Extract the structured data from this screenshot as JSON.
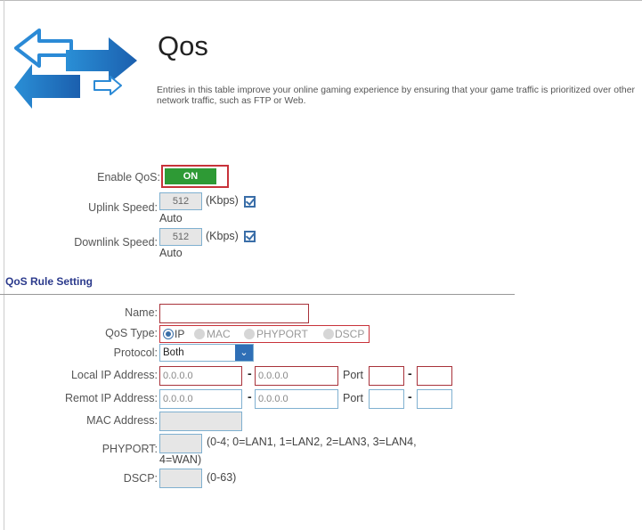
{
  "page": {
    "title": "Qos",
    "description": "Entries in this table improve your online gaming experience by ensuring that your game traffic is prioritized over other network traffic, such as FTP or Web."
  },
  "icons": {
    "logo": "bidirectional-arrows-logo-icon"
  },
  "colors": {
    "toggle_on": "#2e9a35",
    "highlight_border": "#c8323a",
    "section_title": "#2b3a8c",
    "select_arrow": "#2f6fb6"
  },
  "enable_qos": {
    "label": "Enable QoS:",
    "toggle_label": "ON",
    "state": "on"
  },
  "uplink": {
    "label": "Uplink Speed:",
    "value": "512",
    "unit": "(Kbps)",
    "auto_label": "Auto",
    "auto_checked": true
  },
  "downlink": {
    "label": "Downlink Speed:",
    "value": "512",
    "unit": "(Kbps)",
    "auto_label": "Auto",
    "auto_checked": true
  },
  "rule": {
    "section_title": "QoS Rule Setting",
    "name_label": "Name:",
    "name_value": "",
    "qos_type_label": "QoS Type:",
    "qos_types": [
      "IP",
      "MAC",
      "PHYPORT",
      "DSCP"
    ],
    "qos_type_selected": "IP",
    "protocol_label": "Protocol:",
    "protocol_value": "Both",
    "local_ip_label": "Local IP Address:",
    "local_ip_start": "0.0.0.0",
    "local_ip_end": "0.0.0.0",
    "remote_ip_label": "Remot IP Address:",
    "remote_ip_start": "0.0.0.0",
    "remote_ip_end": "0.0.0.0",
    "port_label": "Port",
    "range_separator": "-",
    "mac_label": "MAC Address:",
    "phyport_label": "PHYPORT:",
    "phyport_hint_line1": "(0-4; 0=LAN1, 1=LAN2, 2=LAN3, 3=LAN4,",
    "phyport_hint_line2": "4=WAN)",
    "dscp_label": "DSCP:",
    "dscp_hint": "(0-63)"
  }
}
